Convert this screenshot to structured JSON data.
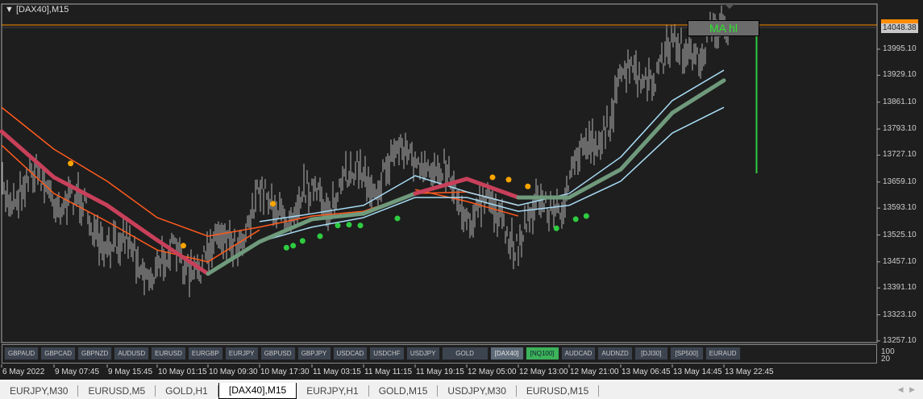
{
  "window": {
    "title": "[DAX40],M15",
    "menu_icon": "triangle-down-icon"
  },
  "chart_data": {
    "type": "candlestick",
    "symbol": "[DAX40]",
    "timeframe": "M15",
    "y_ticks": [
      "13995.10",
      "13929.10",
      "13861.10",
      "13793.10",
      "13727.10",
      "13659.10",
      "13593.10",
      "13525.10",
      "13457.10",
      "13391.10",
      "13323.10",
      "13257.10"
    ],
    "ylim": [
      13257.1,
      14048.38
    ],
    "current_price": "14048.38",
    "x_ticks": [
      "6 May 2022",
      "9 May 07:45",
      "9 May 15:45",
      "10 May 01:15",
      "10 May 09:30",
      "10 May 17:30",
      "11 May 03:15",
      "11 May 11:15",
      "11 May 19:15",
      "12 May 05:00",
      "12 May 13:00",
      "12 May 21:00",
      "13 May 06:45",
      "13 May 14:45",
      "13 May 22:45"
    ],
    "approx_close_at_ticks": [
      13650,
      13650,
      13508,
      13447,
      13467,
      13600,
      13610,
      13671,
      13732,
      13610,
      13528,
      13650,
      13895,
      13977,
      14028
    ],
    "series": [
      {
        "role": "ma-thick",
        "values": [
          13787,
          13671,
          13600,
          13512,
          13427,
          13508,
          13565,
          13579,
          13630,
          13667,
          13620,
          13620,
          13691,
          13834,
          13916
        ],
        "regime": [
          "down",
          "down",
          "down",
          "down",
          "up",
          "up",
          "up",
          "up",
          "down",
          "down",
          "up",
          "up",
          "up",
          "up",
          "up"
        ]
      },
      {
        "role": "upper-orange",
        "values": [
          13848,
          13742,
          13661,
          13569,
          13522,
          13545,
          13573,
          13585,
          13630,
          13634,
          13600,
          null,
          null,
          null,
          null
        ]
      },
      {
        "role": "lower-orange",
        "values": [
          13752,
          13630,
          13559,
          13487,
          13457,
          13538,
          null,
          null,
          13640,
          13610,
          13573,
          null,
          null,
          null,
          null
        ]
      },
      {
        "role": "upper-lightblue",
        "values": [
          null,
          null,
          null,
          null,
          null,
          13559,
          13579,
          13600,
          13675,
          13634,
          13600,
          13630,
          13722,
          13865,
          13942
        ]
      },
      {
        "role": "lower-lightblue",
        "values": [
          null,
          null,
          null,
          null,
          null,
          13508,
          13545,
          13569,
          13620,
          13620,
          13585,
          13600,
          13661,
          13783,
          13848
        ]
      }
    ],
    "orange_dots": [
      {
        "t": "9 May 10:15",
        "p": 13706
      },
      {
        "t": "10 May 05:30",
        "p": 13498
      },
      {
        "t": "10 May 20:00",
        "p": 13604
      },
      {
        "t": "12 May 09:00",
        "p": 13671
      },
      {
        "t": "12 May 11:30",
        "p": 13665
      },
      {
        "t": "12 May 14:30",
        "p": 13648
      }
    ],
    "green_dots": [
      {
        "t": "10 May 22:30",
        "p": 13493
      },
      {
        "t": "10 May 23:45",
        "p": 13498
      },
      {
        "t": "11 May 01:30",
        "p": 13510
      },
      {
        "t": "11 May 04:30",
        "p": 13522
      },
      {
        "t": "11 May 07:15",
        "p": 13549
      },
      {
        "t": "11 May 09:00",
        "p": 13551
      },
      {
        "t": "11 May 10:45",
        "p": 13549
      },
      {
        "t": "11 May 16:30",
        "p": 13567
      },
      {
        "t": "12 May 19:00",
        "p": 13542
      },
      {
        "t": "12 May 22:15",
        "p": 13565
      },
      {
        "t": "13 May 00:15",
        "p": 13573
      }
    ],
    "colors": {
      "bg": "#1e1e1e",
      "candles": "#b4b4b4",
      "ma_down": "#c8405a",
      "ma_up": "#6f9a7c",
      "orange": "#ff5a1e",
      "lightblue": "#a8dcf5",
      "dot_orange": "#ffa500",
      "dot_green": "#2ecc40",
      "price_line": "#ff8c00",
      "vline": "#2ecc40"
    }
  },
  "ma_label": "MA hl",
  "symbol_buttons": [
    "GBPAUD",
    "GBPCAD",
    "GBPNZD",
    "AUDUSD",
    "EURUSD",
    "EURGBP",
    "EURJPY",
    "GBPUSD",
    "GBPJPY",
    "USDCAD",
    "USDCHF",
    "USDJPY",
    "GOLD",
    "[DAX40]",
    "[NQ100]",
    "AUDCAD",
    "AUDNZD",
    "[DJI30]",
    "[SP500]",
    "EURAUD"
  ],
  "active_button": "[DAX40]",
  "highlight_button": "[NQ100]",
  "indicator_levels": [
    "100",
    "20"
  ],
  "tabs": [
    "EURJPY,M30",
    "EURUSD,M5",
    "GOLD,H1",
    "[DAX40],M15",
    "EURJPY,H1",
    "GOLD,M15",
    "USDJPY,M30",
    "EURUSD,M15"
  ],
  "selected_tab": "[DAX40],M15"
}
